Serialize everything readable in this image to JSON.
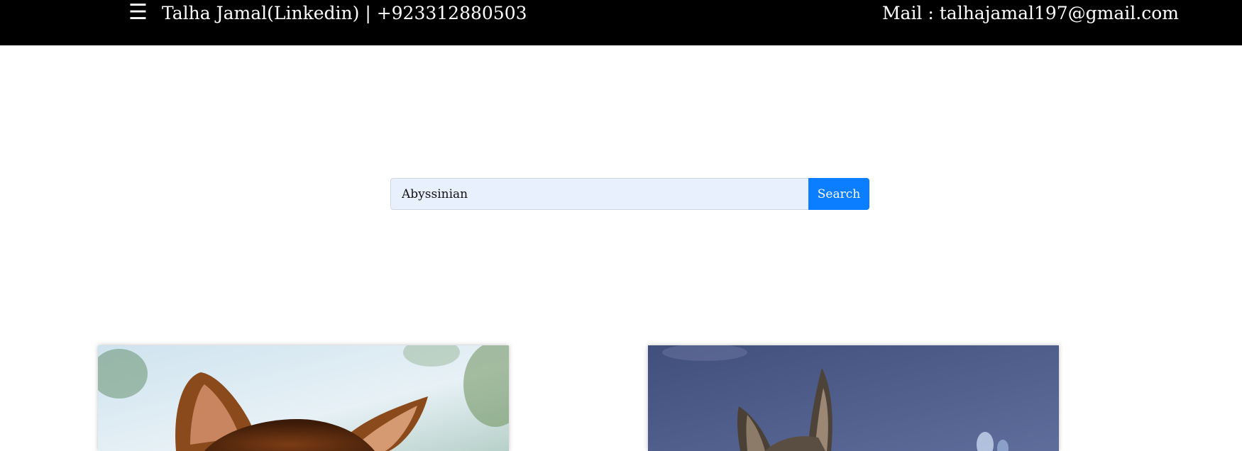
{
  "header": {
    "menu_icon": "hamburger-menu-icon",
    "contact_text": "Talha Jamal(Linkedin) | +923312880503",
    "link_text": "Talha Jamal(Linkedin)",
    "separator": " | ",
    "phone": "+923312880503",
    "mail_label": "Mail : talhajamal197@gmail.com"
  },
  "search": {
    "value": "Abyssinian",
    "button_label": "Search",
    "button_color": "#0b7dff",
    "input_bg": "#e8f0fe"
  },
  "results": [
    {
      "image": "abyssinian-cat-photo-1"
    },
    {
      "image": "abyssinian-cat-photo-2"
    }
  ]
}
